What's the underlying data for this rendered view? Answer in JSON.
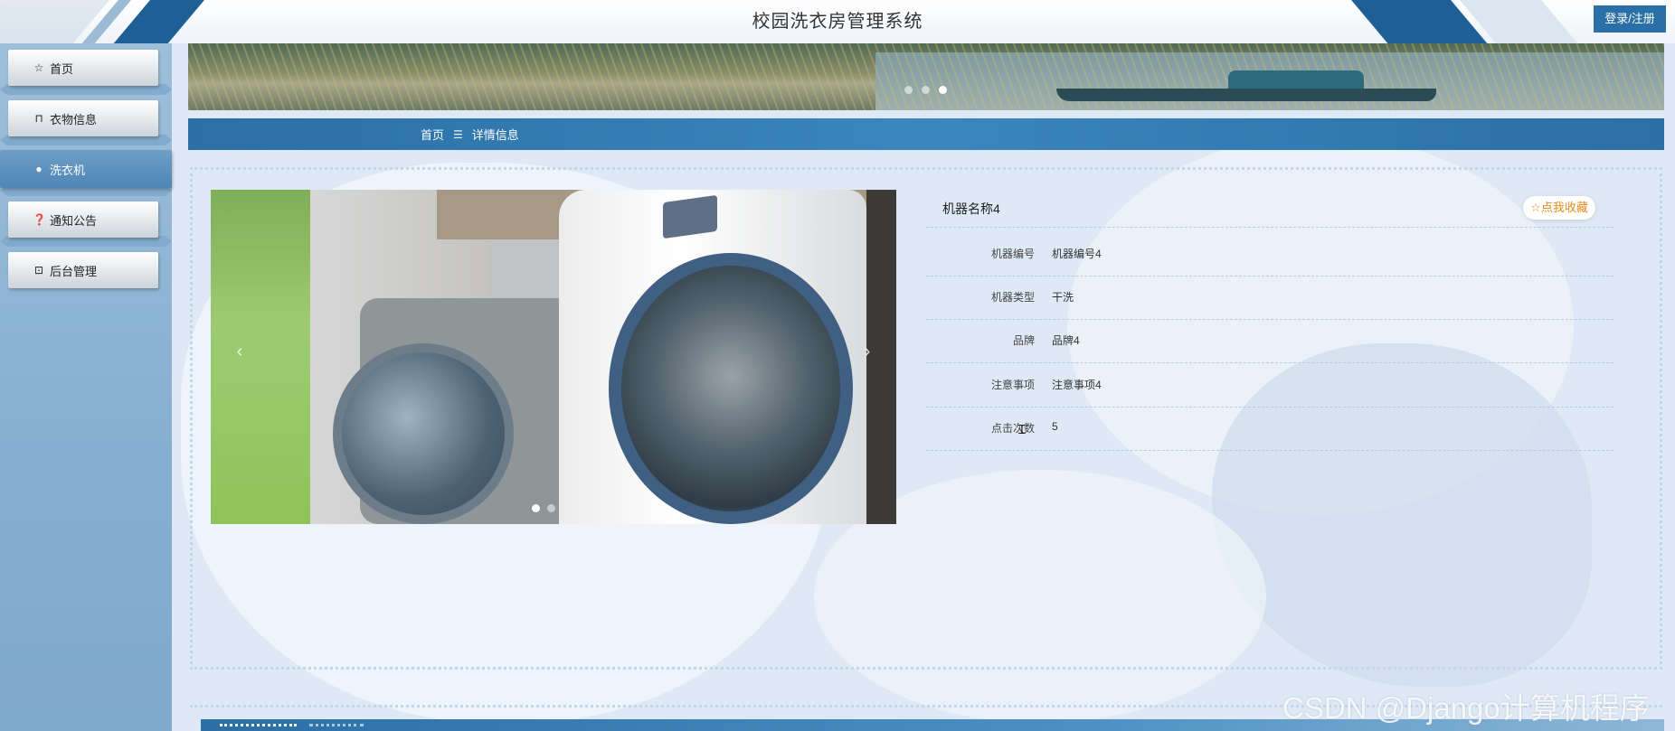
{
  "header": {
    "title": "校园洗衣房管理系统",
    "login_label": "登录/注册"
  },
  "sidebar": {
    "items": [
      {
        "label": "首页",
        "icon": "star-outline-icon"
      },
      {
        "label": "衣物信息",
        "icon": "bag-icon"
      },
      {
        "label": "洗衣机",
        "icon": "circle-icon",
        "active": true
      },
      {
        "label": "通知公告",
        "icon": "help-circle-icon"
      },
      {
        "label": "后台管理",
        "icon": "briefcase-icon"
      }
    ]
  },
  "banner": {
    "slides": 3,
    "active_slide": 3
  },
  "breadcrumb": {
    "home": "首页",
    "separator": "☰",
    "current": "详情信息"
  },
  "gallery": {
    "slides": 2,
    "active_slide": 1,
    "prev_label": "‹",
    "next_label": "›"
  },
  "detail": {
    "title": "机器名称4",
    "favorite_label": "☆点我收藏",
    "rows": [
      {
        "label": "机器编号",
        "value": "机器编号4"
      },
      {
        "label": "机器类型",
        "value": "干洗"
      },
      {
        "label": "品牌",
        "value": "品牌4"
      },
      {
        "label": "注意事项",
        "value": "注意事项4"
      },
      {
        "label": "点击次数",
        "value": "5"
      }
    ]
  },
  "watermark": "CSDN @Django计算机程序",
  "colors": {
    "primary": "#2b6fa5",
    "accent": "#e58b1e",
    "background": "#dfe9f5"
  }
}
